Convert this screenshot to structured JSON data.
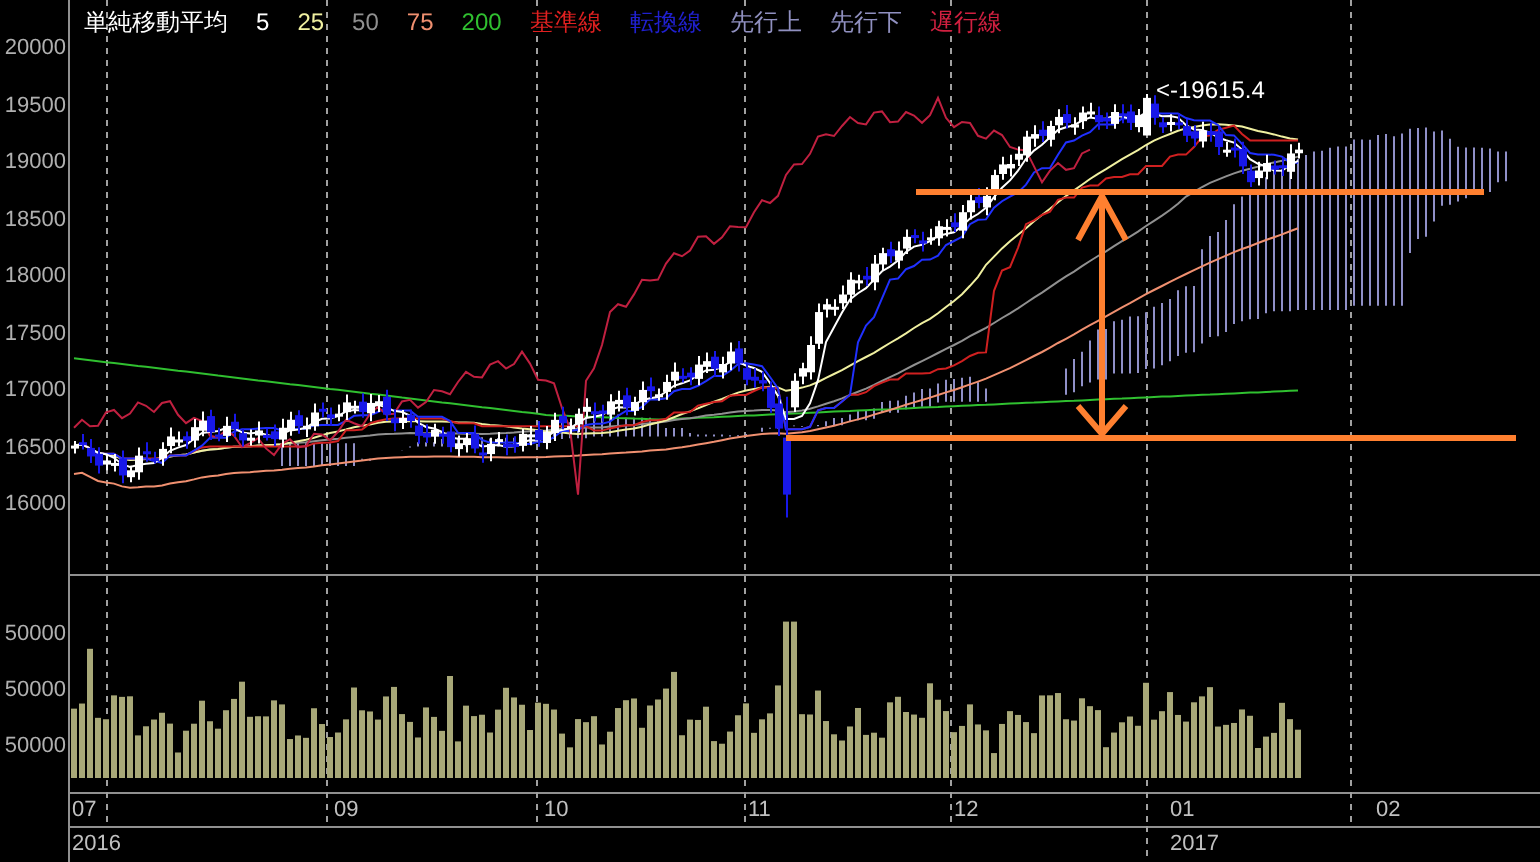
{
  "legend": {
    "title": "単純移動平均",
    "items": [
      {
        "label": "5",
        "color": "#ffffff"
      },
      {
        "label": "25",
        "color": "#f0f0a0"
      },
      {
        "label": "50",
        "color": "#909090"
      },
      {
        "label": "75",
        "color": "#f09070"
      },
      {
        "label": "200",
        "color": "#30c030"
      },
      {
        "label": "基準線",
        "color": "#e02020"
      },
      {
        "label": "転換線",
        "color": "#2020d0"
      },
      {
        "label": "先行上",
        "color": "#9090c0"
      },
      {
        "label": "先行下",
        "color": "#9090c0"
      },
      {
        "label": "遅行線",
        "color": "#d02040"
      }
    ]
  },
  "price_axis": {
    "labels": [
      "20000",
      "19500",
      "19000",
      "18500",
      "18000",
      "17500",
      "17000",
      "16500",
      "16000"
    ]
  },
  "annotation": {
    "text": "<-19615.4"
  },
  "volume_axis": {
    "labels": [
      "50000",
      "50000",
      "50000"
    ]
  },
  "month_labels": [
    "07",
    "09",
    "10",
    "11",
    "12",
    "01",
    "02"
  ],
  "year_labels": [
    "2016",
    "2017"
  ]
}
